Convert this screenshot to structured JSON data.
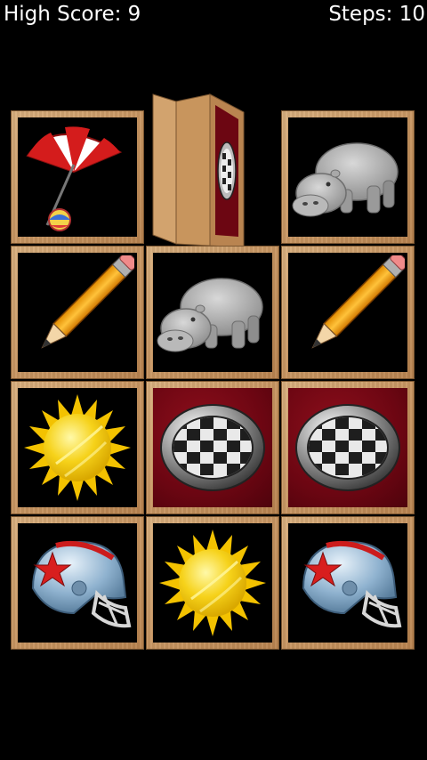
{
  "hud": {
    "high_score_label": "High Score: 9",
    "steps_label": "Steps: 10"
  },
  "board": {
    "rows": 4,
    "cols": 3,
    "tiles": [
      {
        "row": 0,
        "col": 0,
        "icon": "beach-umbrella-icon",
        "state": "revealed"
      },
      {
        "row": 0,
        "col": 1,
        "icon": "checkered-button-icon",
        "state": "flipping"
      },
      {
        "row": 0,
        "col": 2,
        "icon": "hippo-icon",
        "state": "revealed"
      },
      {
        "row": 1,
        "col": 0,
        "icon": "pencil-icon",
        "state": "revealed"
      },
      {
        "row": 1,
        "col": 1,
        "icon": "hippo-icon",
        "state": "revealed"
      },
      {
        "row": 1,
        "col": 2,
        "icon": "pencil-icon",
        "state": "revealed"
      },
      {
        "row": 2,
        "col": 0,
        "icon": "sun-icon",
        "state": "revealed"
      },
      {
        "row": 2,
        "col": 1,
        "icon": "checkered-button-icon",
        "state": "revealed"
      },
      {
        "row": 2,
        "col": 2,
        "icon": "checkered-button-icon",
        "state": "revealed"
      },
      {
        "row": 3,
        "col": 0,
        "icon": "football-helmet-icon",
        "state": "revealed"
      },
      {
        "row": 3,
        "col": 1,
        "icon": "sun-icon",
        "state": "revealed"
      },
      {
        "row": 3,
        "col": 2,
        "icon": "football-helmet-icon",
        "state": "revealed"
      }
    ]
  },
  "colors": {
    "background": "#000000",
    "wood": "#c89662",
    "card_red": "#6c0612",
    "text": "#ffffff"
  }
}
